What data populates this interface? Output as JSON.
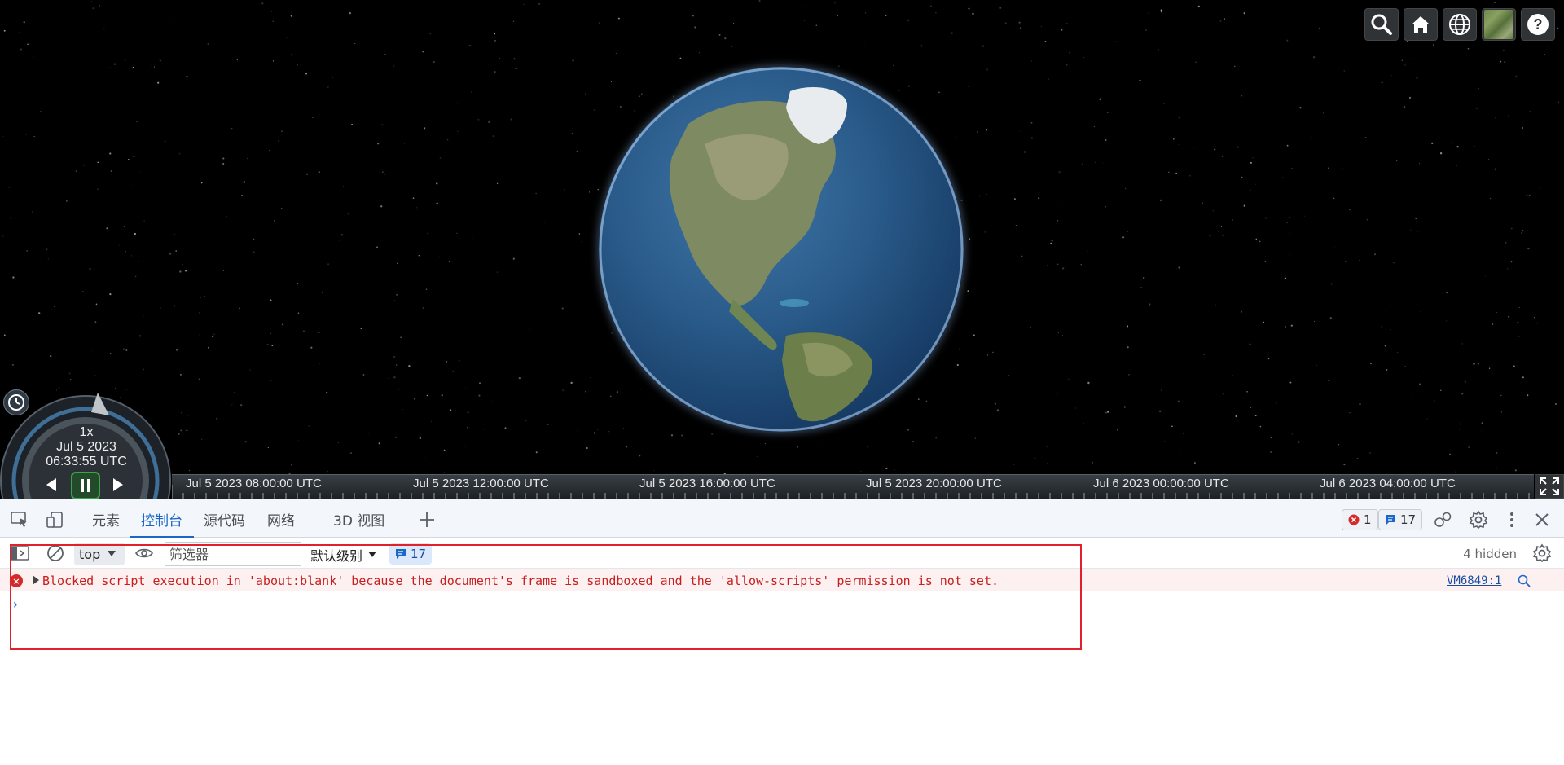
{
  "viewer": {
    "animation": {
      "speed": "1x",
      "date": "Jul 5 2023",
      "time": "06:33:55 UTC"
    },
    "timeline": {
      "labels": [
        "Jul 5 2023 08:00:00 UTC",
        "Jul 5 2023 12:00:00 UTC",
        "Jul 5 2023 16:00:00 UTC",
        "Jul 5 2023 20:00:00 UTC",
        "Jul 6 2023 00:00:00 UTC",
        "Jul 6 2023 04:00:00 UTC"
      ]
    },
    "toolbar_icons": [
      "search-icon",
      "home-icon",
      "globe-icon",
      "imagery-thumbnail",
      "help-icon"
    ]
  },
  "devtools": {
    "tabs": [
      {
        "label": "元素"
      },
      {
        "label": "控制台"
      },
      {
        "label": "源代码"
      },
      {
        "label": "网络"
      },
      {
        "label": "3D 视图"
      }
    ],
    "active_tab": "控制台",
    "error_count": "1",
    "message_count": "17",
    "console": {
      "context": "top",
      "filter_placeholder": "筛选器",
      "filter_value": "",
      "level": "默认级别",
      "message_count": "17",
      "hidden": "4 hidden",
      "error_message": "Blocked script execution in 'about:blank' because the document's frame is sandboxed and the 'allow-scripts' permission is not set.",
      "error_source": "VM6849:1",
      "prompt": "›"
    },
    "colors": {
      "accent": "#1a66c9",
      "error": "#c81e1e",
      "highlight": "#e0202a"
    }
  }
}
